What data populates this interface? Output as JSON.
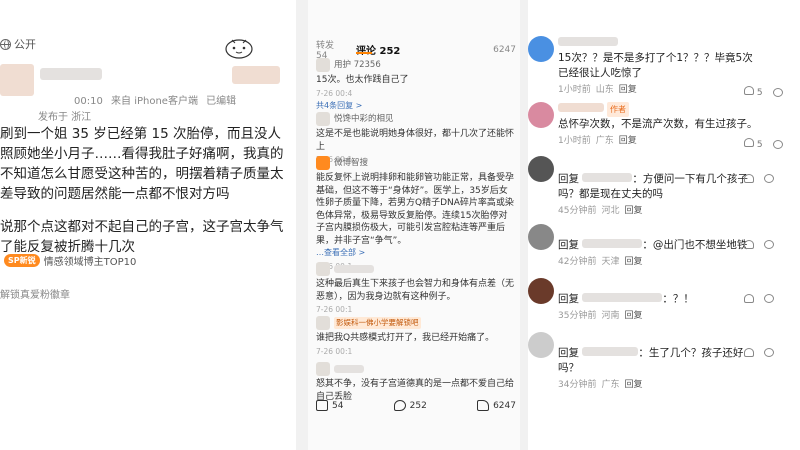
{
  "panel1": {
    "visibility": "公开",
    "meta_time": "00:10",
    "meta_client": "来自 iPhone客户端",
    "meta_edited": "已编辑",
    "location": "发布于 浙江",
    "paragraph1": "刷到一个姐 35 岁已经第 15 次胎停，而且没人照顾她坐小月子……看得我肚子好痛啊，我真的不知道怎么甘愿受这种苦的，明摆着精子质量太差导致的问题居然能一点都不恨对方吗",
    "paragraph2": "说那个点这都对不起自己的子宫，这子宫太争气了能反复被折腾十几次",
    "badge_pill": "SP新锐",
    "badge_text": "情感领域博主TOP10",
    "footer": "解锁真爱粉徽章"
  },
  "panel2": {
    "tab_reposts": "转发 54",
    "tab_comments": "评论 252",
    "tab_likes": "6247",
    "comments": [
      {
        "name": "用护 72356",
        "text": "15次。也太作践自己了",
        "time": "7-26 00:4",
        "replies": "共4条回复 >"
      },
      {
        "name": "悦馋中彩的相见",
        "text": "这是不是也能说明她身体很好，都十几次了还能怀上",
        "time": "7-26 00:1",
        "replies": ""
      },
      {
        "name": "微博智搜",
        "text": "能反复怀上说明排卵和能卵管功能正常，具备受孕基础，但这不等于“身体好”。医学上，35岁后女性卵子质量下降，若男方Q精子DNA碎片率高或染色体异常，极易导致反复胎停。连续15次胎停对子宫内膜损伤极大，可能引发宫腔粘连等严重后果，并非子宫“争气”。",
        "tag": "…查看全部 >",
        "time": "7-26 00:1",
        "replies": ""
      },
      {
        "name": "",
        "text": "这种最后真生下来孩子也会智力和身体有点差（无恶意），因为我身边就有这种例子。",
        "time": "7-26 00:1",
        "replies": ""
      },
      {
        "name": "影娱科一佛小学要解锁吧",
        "text": "谁把我Q共感模式打开了，我已经开始痛了。",
        "time": "7-26 00:1",
        "replies": ""
      },
      {
        "name": "",
        "text": "怒其不争，没有子宫道德真的是一点都不爱自己给自己丢脸",
        "time": "",
        "replies": ""
      }
    ],
    "bar_reposts": "54",
    "bar_comments": "252",
    "bar_likes": "6247"
  },
  "panel3": {
    "comments": [
      {
        "text": "15次？？是不是多打了个1？？？毕竟5次已经很让人吃惊了",
        "time": "1小时前",
        "loc": "山东",
        "reply": "回复",
        "likes": "5"
      },
      {
        "badge": "作者",
        "text": "总怀孕次数，不是流产次数，有生过孩子。",
        "time": "1小时前",
        "loc": "广东",
        "reply": "回复",
        "likes": "5"
      },
      {
        "prefix": "回复",
        "text": "方便问一下有几个孩子吗？都是现在丈夫的吗",
        "time": "45分钟前",
        "loc": "河北",
        "reply": "回复",
        "likes": ""
      },
      {
        "prefix": "回复",
        "text": "@出门也不想坐地铁",
        "time": "42分钟前",
        "loc": "天津",
        "reply": "回复",
        "likes": ""
      },
      {
        "prefix": "回复",
        "text": "？！",
        "time": "35分钟前",
        "loc": "河南",
        "reply": "回复",
        "likes": ""
      },
      {
        "prefix": "回复",
        "text": "生了几个？孩子还好吗？",
        "time": "34分钟前",
        "loc": "广东",
        "reply": "回复",
        "likes": ""
      }
    ]
  }
}
